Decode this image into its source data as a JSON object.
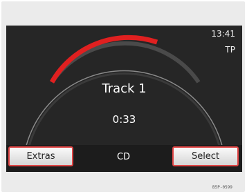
{
  "status": {
    "clock": "13:41",
    "tp": "TP"
  },
  "track": {
    "title": "Track 1",
    "elapsed": "0:33"
  },
  "bottom_bar": {
    "left_button": "Extras",
    "mode": "CD",
    "right_button": "Select"
  },
  "figure_code": "B5P-0599",
  "colors": {
    "accent": "#e02020",
    "screen": "#262626",
    "frame": "#ebebeb"
  }
}
